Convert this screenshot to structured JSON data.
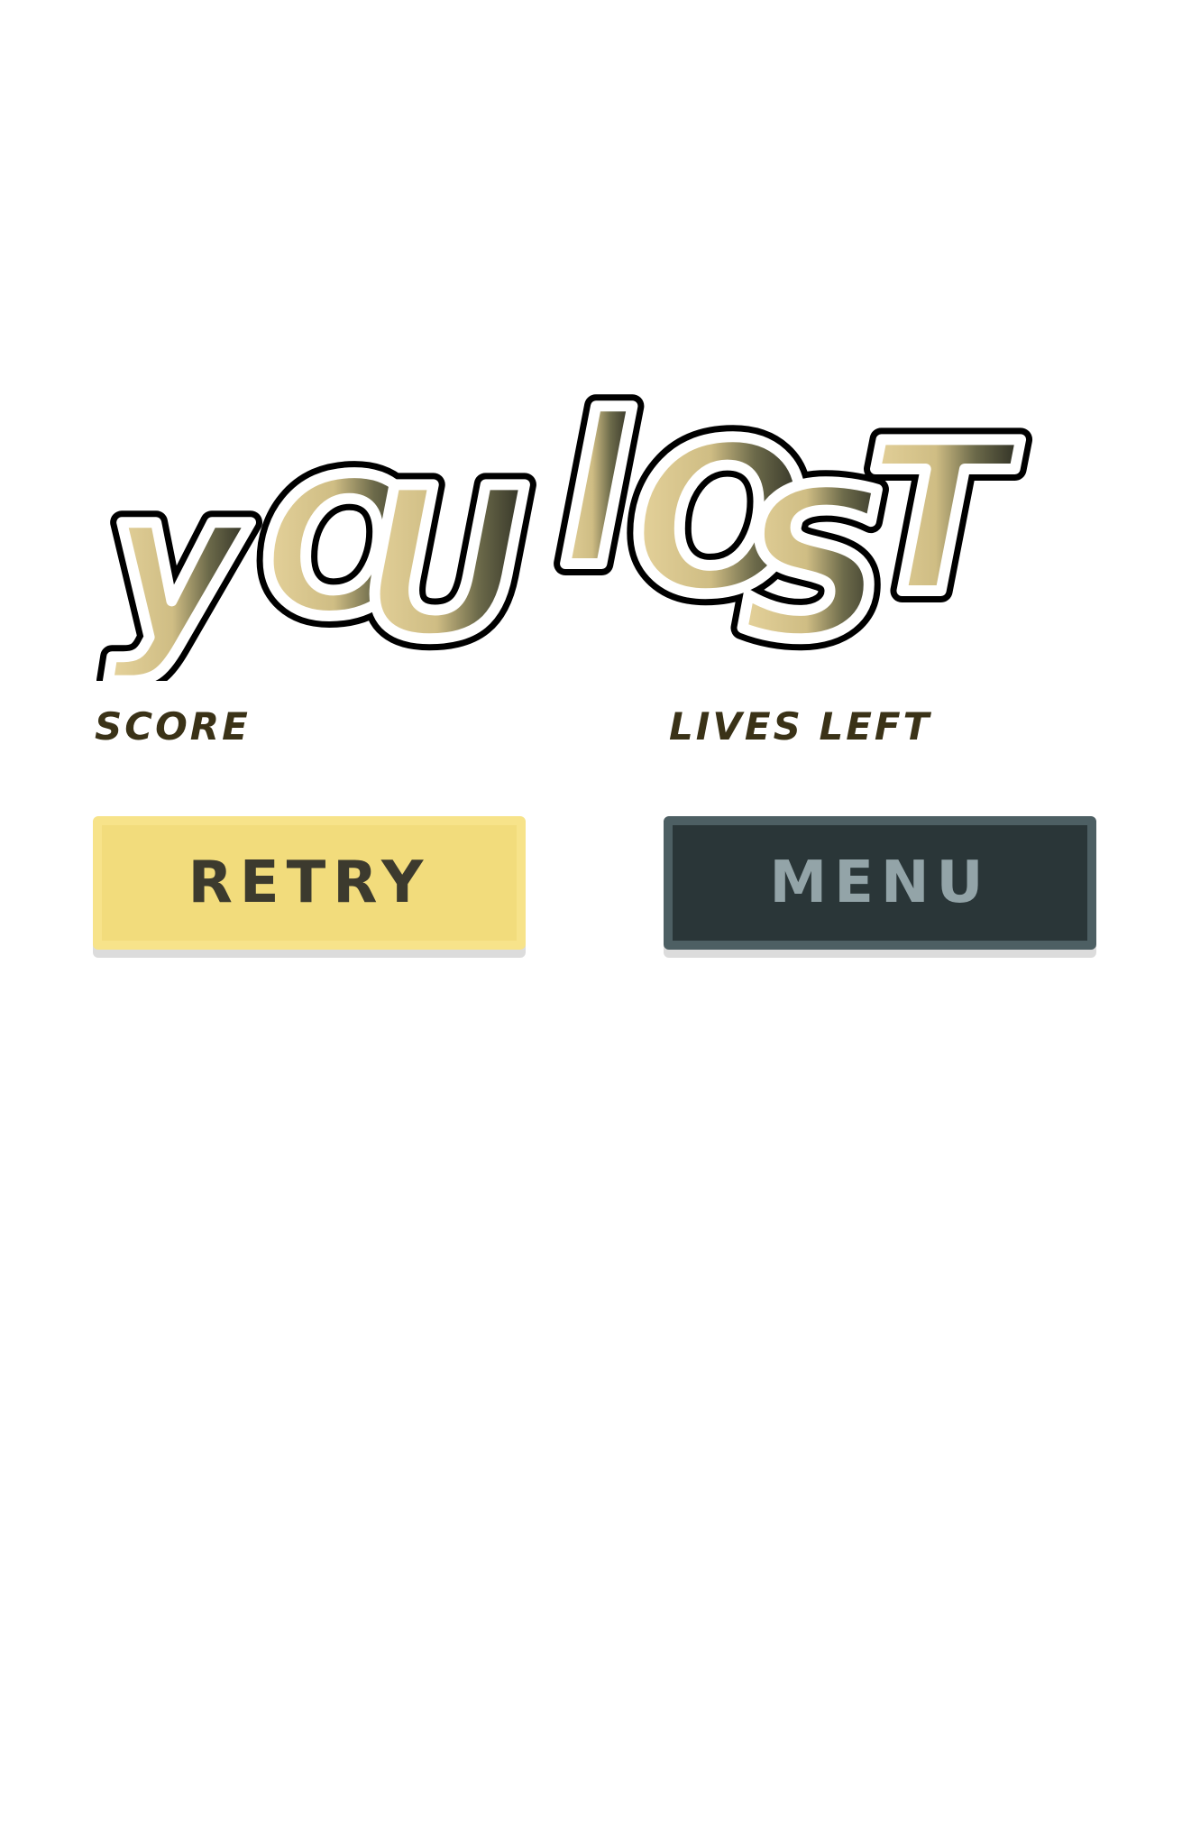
{
  "title": {
    "text": "YOU LOST",
    "logo_icon": "you-lost-logo-icon"
  },
  "stats": {
    "score_label": "SCORE",
    "lives_label": "LIVES LEFT"
  },
  "buttons": {
    "retry_label": "RETRY",
    "menu_label": "MENU"
  },
  "colors": {
    "retry_bg": "#f2dc7c",
    "menu_bg": "#2a3638",
    "label_text": "#3a3217",
    "menu_text": "#93a4a8"
  }
}
